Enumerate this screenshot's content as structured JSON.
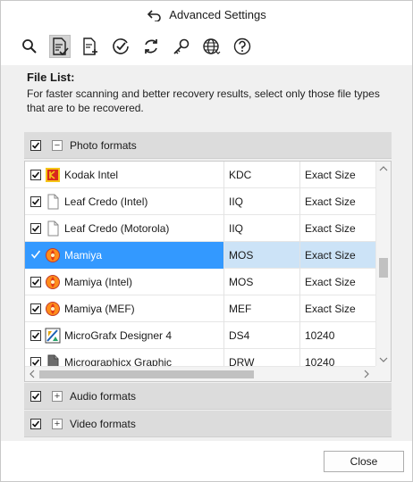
{
  "window": {
    "title": "Advanced Settings"
  },
  "toolbar": {
    "items": [
      {
        "name": "search-icon"
      },
      {
        "name": "file-list-icon",
        "active": true
      },
      {
        "name": "add-file-icon"
      },
      {
        "name": "check-circle-icon"
      },
      {
        "name": "refresh-icon"
      },
      {
        "name": "key-icon"
      },
      {
        "name": "globe-icon"
      },
      {
        "name": "help-icon"
      }
    ]
  },
  "filelist": {
    "title": "File List:",
    "description": "For faster scanning and better recovery results, select only those file types that are to be recovered."
  },
  "groups": {
    "photo": {
      "label": "Photo formats",
      "checked": true,
      "expanded": true
    },
    "audio": {
      "label": "Audio formats",
      "checked": true,
      "expanded": false
    },
    "video": {
      "label": "Video formats",
      "checked": true,
      "expanded": false
    }
  },
  "rows": [
    {
      "name": "Kodak Intel",
      "ext": "KDC",
      "size": "Exact Size",
      "icon": "kodak-icon",
      "checked": true,
      "selected": false
    },
    {
      "name": "Leaf Credo (Intel)",
      "ext": "IIQ",
      "size": "Exact Size",
      "icon": "generic-file-icon",
      "checked": true,
      "selected": false
    },
    {
      "name": "Leaf Credo (Motorola)",
      "ext": "IIQ",
      "size": "Exact Size",
      "icon": "generic-file-icon",
      "checked": true,
      "selected": false
    },
    {
      "name": "Mamiya",
      "ext": "MOS",
      "size": "Exact Size",
      "icon": "mamiya-icon",
      "checked": true,
      "selected": true
    },
    {
      "name": "Mamiya (Intel)",
      "ext": "MOS",
      "size": "Exact Size",
      "icon": "mamiya-icon",
      "checked": true,
      "selected": false
    },
    {
      "name": "Mamiya (MEF)",
      "ext": "MEF",
      "size": "Exact Size",
      "icon": "mamiya-icon",
      "checked": true,
      "selected": false
    },
    {
      "name": "MicroGrafx Designer 4",
      "ext": "DS4",
      "size": "10240",
      "icon": "micrografx-icon",
      "checked": true,
      "selected": false
    },
    {
      "name": "Micrographicx Graphic",
      "ext": "DRW",
      "size": "10240",
      "icon": "drw-file-icon",
      "checked": true,
      "selected": false
    }
  ],
  "footer": {
    "close_label": "Close"
  },
  "colors": {
    "selection": "#3399ff",
    "group_header": "#dcdcdc",
    "content_bg": "#f0f0f0"
  }
}
